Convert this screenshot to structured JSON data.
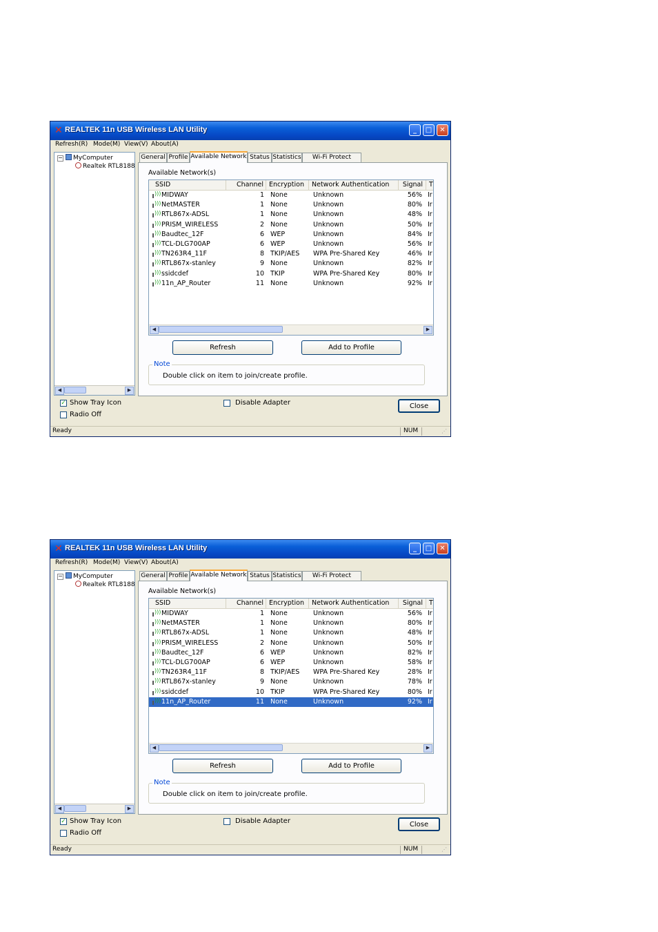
{
  "windows": [
    {
      "title": "REALTEK 11n USB Wireless LAN Utility",
      "menu": [
        "Refresh(R)",
        "Mode(M)",
        "View(V)",
        "About(A)"
      ],
      "tree": {
        "root": "MyComputer",
        "child": "Realtek RTL8188"
      },
      "tabs": [
        "General",
        "Profile",
        "Available Network",
        "Status",
        "Statistics",
        "Wi-Fi Protect Setup"
      ],
      "active_tab": 2,
      "available_label": "Available Network(s)",
      "columns": [
        "SSID",
        "Channel",
        "Encryption",
        "Network Authentication",
        "Signal",
        "T"
      ],
      "rows": [
        [
          "MIDWAY",
          "1",
          "None",
          "Unknown",
          "56%",
          "Ir"
        ],
        [
          "NetMASTER",
          "1",
          "None",
          "Unknown",
          "80%",
          "Ir"
        ],
        [
          "RTL867x-ADSL",
          "1",
          "None",
          "Unknown",
          "48%",
          "Ir"
        ],
        [
          "PRISM_WIRELESS",
          "2",
          "None",
          "Unknown",
          "50%",
          "Ir"
        ],
        [
          "Baudtec_12F",
          "6",
          "WEP",
          "Unknown",
          "84%",
          "Ir"
        ],
        [
          "TCL-DLG700AP",
          "6",
          "WEP",
          "Unknown",
          "56%",
          "Ir"
        ],
        [
          "TN263R4_11F",
          "8",
          "TKIP/AES",
          "WPA Pre-Shared Key",
          "46%",
          "Ir"
        ],
        [
          "RTL867x-stanley",
          "9",
          "None",
          "Unknown",
          "82%",
          "Ir"
        ],
        [
          "ssidcdef",
          "10",
          "TKIP",
          "WPA Pre-Shared Key",
          "80%",
          "Ir"
        ],
        [
          "11n_AP_Router",
          "11",
          "None",
          "Unknown",
          "92%",
          "Ir"
        ]
      ],
      "selected_row": null,
      "refresh_label": "Refresh",
      "add_profile_label": "Add to Profile",
      "note_title": "Note",
      "note_text": "Double click on item to join/create profile.",
      "show_tray_label": "Show Tray Icon",
      "show_tray_checked": true,
      "radio_off_label": "Radio Off",
      "radio_off_checked": false,
      "disable_adapter_label": "Disable Adapter",
      "disable_adapter_checked": false,
      "close_label": "Close",
      "status": "Ready",
      "num_indicator": "NUM"
    },
    {
      "title": "REALTEK 11n USB Wireless LAN Utility",
      "menu": [
        "Refresh(R)",
        "Mode(M)",
        "View(V)",
        "About(A)"
      ],
      "tree": {
        "root": "MyComputer",
        "child": "Realtek RTL8188"
      },
      "tabs": [
        "General",
        "Profile",
        "Available Network",
        "Status",
        "Statistics",
        "Wi-Fi Protect Setup"
      ],
      "active_tab": 2,
      "available_label": "Available Network(s)",
      "columns": [
        "SSID",
        "Channel",
        "Encryption",
        "Network Authentication",
        "Signal",
        "T"
      ],
      "rows": [
        [
          "MIDWAY",
          "1",
          "None",
          "Unknown",
          "56%",
          "Ir"
        ],
        [
          "NetMASTER",
          "1",
          "None",
          "Unknown",
          "80%",
          "Ir"
        ],
        [
          "RTL867x-ADSL",
          "1",
          "None",
          "Unknown",
          "48%",
          "Ir"
        ],
        [
          "PRISM_WIRELESS",
          "2",
          "None",
          "Unknown",
          "50%",
          "Ir"
        ],
        [
          "Baudtec_12F",
          "6",
          "WEP",
          "Unknown",
          "82%",
          "Ir"
        ],
        [
          "TCL-DLG700AP",
          "6",
          "WEP",
          "Unknown",
          "58%",
          "Ir"
        ],
        [
          "TN263R4_11F",
          "8",
          "TKIP/AES",
          "WPA Pre-Shared Key",
          "28%",
          "Ir"
        ],
        [
          "RTL867x-stanley",
          "9",
          "None",
          "Unknown",
          "78%",
          "Ir"
        ],
        [
          "ssidcdef",
          "10",
          "TKIP",
          "WPA Pre-Shared Key",
          "80%",
          "Ir"
        ],
        [
          "11n_AP_Router",
          "11",
          "None",
          "Unknown",
          "92%",
          "Ir"
        ]
      ],
      "selected_row": 9,
      "refresh_label": "Refresh",
      "add_profile_label": "Add to Profile",
      "note_title": "Note",
      "note_text": "Double click on item to join/create profile.",
      "show_tray_label": "Show Tray Icon",
      "show_tray_checked": true,
      "radio_off_label": "Radio Off",
      "radio_off_checked": false,
      "disable_adapter_label": "Disable Adapter",
      "disable_adapter_checked": false,
      "close_label": "Close",
      "status": "Ready",
      "num_indicator": "NUM"
    }
  ],
  "colors": {
    "title_blue": "#0a5fd8",
    "selection": "#316ac5",
    "active_tab_accent": "#f8a838",
    "note_title": "#0046d5"
  }
}
